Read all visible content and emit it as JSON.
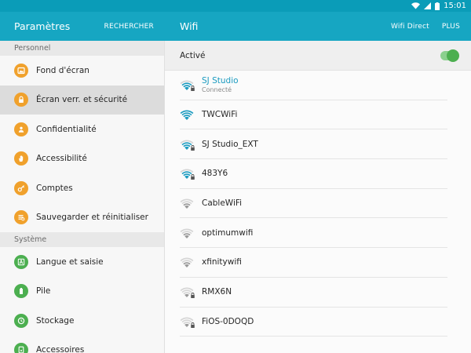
{
  "status_bar": {
    "time": "15:01",
    "icons": [
      "wifi-icon",
      "signal-icon",
      "battery-icon"
    ]
  },
  "left_header": {
    "title": "Paramètres",
    "search_label": "RECHERCHER"
  },
  "right_header": {
    "title": "Wifi",
    "wifi_direct_label": "Wifi Direct",
    "more_label": "PLUS"
  },
  "sections": [
    {
      "header": "Personnel",
      "items": [
        {
          "label": "Fond d'écran",
          "icon": "wallpaper-icon",
          "color": "#f0a12c",
          "selected": false
        },
        {
          "label": "Écran verr. et sécurité",
          "icon": "lock-icon",
          "color": "#f0a12c",
          "selected": true
        },
        {
          "label": "Confidentialité",
          "icon": "privacy-icon",
          "color": "#f0a12c",
          "selected": false
        },
        {
          "label": "Accessibilité",
          "icon": "hand-icon",
          "color": "#f0a12c",
          "selected": false
        },
        {
          "label": "Comptes",
          "icon": "key-icon",
          "color": "#f0a12c",
          "selected": false
        },
        {
          "label": "Sauvegarder et réinitialiser",
          "icon": "backup-icon",
          "color": "#f0a12c",
          "selected": false
        }
      ]
    },
    {
      "header": "Système",
      "items": [
        {
          "label": "Langue et saisie",
          "icon": "language-icon",
          "color": "#4caf50",
          "selected": false
        },
        {
          "label": "Pile",
          "icon": "battery-icon",
          "color": "#4caf50",
          "selected": false
        },
        {
          "label": "Stockage",
          "icon": "storage-icon",
          "color": "#4caf50",
          "selected": false
        },
        {
          "label": "Accessoires",
          "icon": "accessory-icon",
          "color": "#4caf50",
          "selected": false
        }
      ]
    }
  ],
  "wifi": {
    "active_label": "Activé",
    "enabled": true,
    "networks": [
      {
        "name": "SJ Studio",
        "status": "Connecté",
        "secured": true,
        "connected": true,
        "strength": 3
      },
      {
        "name": "TWCWiFi",
        "status": "",
        "secured": false,
        "connected": false,
        "strength": 4
      },
      {
        "name": "SJ Studio_EXT",
        "status": "",
        "secured": true,
        "connected": false,
        "strength": 3
      },
      {
        "name": "483Y6",
        "status": "",
        "secured": true,
        "connected": false,
        "strength": 3
      },
      {
        "name": "CableWiFi",
        "status": "",
        "secured": false,
        "connected": false,
        "strength": 2
      },
      {
        "name": "optimumwifi",
        "status": "",
        "secured": false,
        "connected": false,
        "strength": 2
      },
      {
        "name": "xfinitywifi",
        "status": "",
        "secured": false,
        "connected": false,
        "strength": 2
      },
      {
        "name": "RMX6N",
        "status": "",
        "secured": true,
        "connected": false,
        "strength": 1
      },
      {
        "name": "FiOS-0DOQD",
        "status": "",
        "secured": true,
        "connected": false,
        "strength": 1
      }
    ]
  },
  "colors": {
    "accent": "#16a6c2",
    "status_bar": "#0a9cb8",
    "wifi_strong": "#1b9bc0",
    "wifi_weak": "#9a9a9a",
    "toggle_on": "#4caf50"
  }
}
